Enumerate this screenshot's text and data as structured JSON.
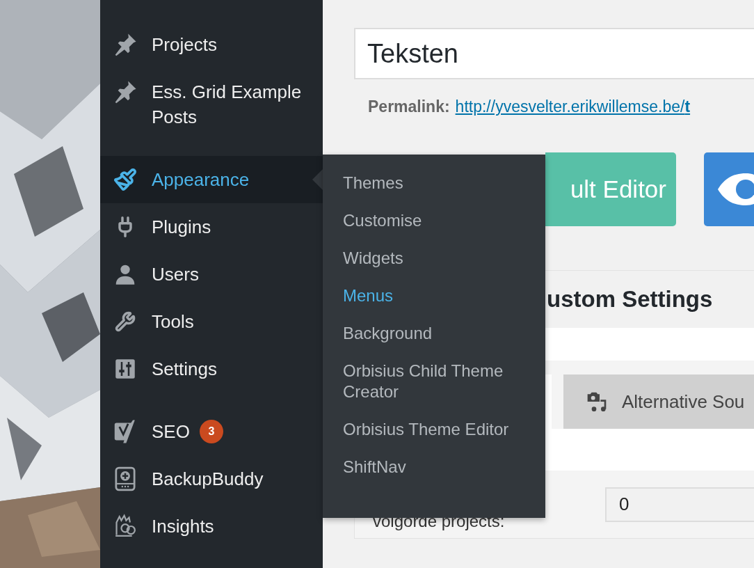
{
  "sidebar": {
    "groups": [
      {
        "items": [
          {
            "label": "Projects",
            "selected": false
          },
          {
            "label": "Ess. Grid Example Posts",
            "selected": false
          }
        ]
      },
      {
        "items": [
          {
            "label": "Appearance",
            "selected": true
          },
          {
            "label": "Plugins",
            "selected": false
          },
          {
            "label": "Users",
            "selected": false
          },
          {
            "label": "Tools",
            "selected": false
          },
          {
            "label": "Settings",
            "selected": false
          }
        ]
      },
      {
        "items": [
          {
            "label": "SEO",
            "selected": false,
            "badge": "3"
          },
          {
            "label": "BackupBuddy",
            "selected": false
          },
          {
            "label": "Insights",
            "selected": false
          }
        ]
      }
    ]
  },
  "flyout": {
    "items": [
      {
        "label": "Themes",
        "selected": false
      },
      {
        "label": "Customise",
        "selected": false
      },
      {
        "label": "Widgets",
        "selected": false
      },
      {
        "label": "Menus",
        "selected": true
      },
      {
        "label": "Background",
        "selected": false
      },
      {
        "label": "Orbisius Child Theme Creator",
        "selected": false
      },
      {
        "label": "Orbisius Theme Editor",
        "selected": false
      },
      {
        "label": "ShiftNav",
        "selected": false
      }
    ]
  },
  "editor": {
    "title_field": {
      "value": "Teksten"
    },
    "permalink": {
      "label": "Permalink:",
      "url": "http://yvesvelter.erikwillemse.be/**t**"
    },
    "buttons": [
      {
        "kind": "text",
        "label": "ult Editor"
      },
      {
        "kind": "icon"
      }
    ]
  },
  "settings_panel": {
    "title": "ustom Settings",
    "tabs": [
      {
        "selected": true
      },
      {
        "label": "Alternative Sou",
        "selected": false
      }
    ],
    "fields": [
      {
        "label": "volgorde projects:",
        "value": "0"
      }
    ]
  }
}
